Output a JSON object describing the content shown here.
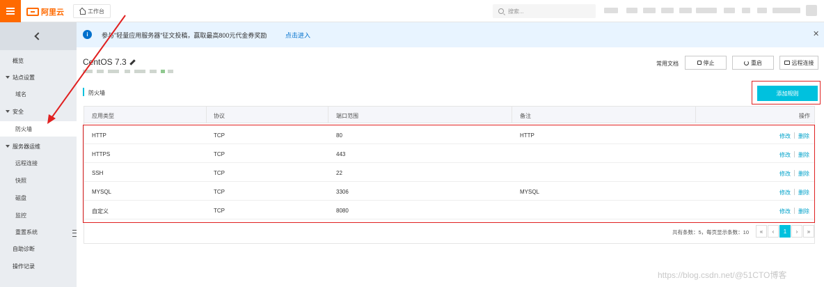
{
  "topbar": {
    "logo_text": "阿里云",
    "workbench_label": "工作台",
    "search_placeholder": "搜索..."
  },
  "sidebar": {
    "items": [
      {
        "label": "概览",
        "kind": "top"
      },
      {
        "label": "站点设置",
        "kind": "group"
      },
      {
        "label": "域名",
        "kind": "sub"
      },
      {
        "label": "安全",
        "kind": "group"
      },
      {
        "label": "防火墙",
        "kind": "sub",
        "active": true
      },
      {
        "label": "服务器运维",
        "kind": "group"
      },
      {
        "label": "远程连接",
        "kind": "sub"
      },
      {
        "label": "快照",
        "kind": "sub"
      },
      {
        "label": "磁盘",
        "kind": "sub"
      },
      {
        "label": "监控",
        "kind": "sub"
      },
      {
        "label": "重置系统",
        "kind": "sub"
      },
      {
        "label": "自助诊断",
        "kind": "top"
      },
      {
        "label": "操作记录",
        "kind": "top"
      }
    ]
  },
  "notice": {
    "text": "参与\"轻量应用服务器\"征文投稿，赢取最高800元代金券奖励",
    "link": "点击进入",
    "close": "✕"
  },
  "instance": {
    "title": "CentOS 7.3"
  },
  "actions": {
    "doc_link": "常用文档",
    "stop": "停止",
    "restart": "重启",
    "remote": "远程连接"
  },
  "firewall": {
    "section_title": "防火墙",
    "add_rule": "添加规则",
    "columns": [
      "应用类型",
      "协议",
      "端口范围",
      "备注",
      "操作"
    ],
    "rows": [
      {
        "type": "HTTP",
        "protocol": "TCP",
        "port": "80",
        "note": "HTTP"
      },
      {
        "type": "HTTPS",
        "protocol": "TCP",
        "port": "443",
        "note": ""
      },
      {
        "type": "SSH",
        "protocol": "TCP",
        "port": "22",
        "note": ""
      },
      {
        "type": "MYSQL",
        "protocol": "TCP",
        "port": "3306",
        "note": "MYSQL"
      },
      {
        "type": "自定义",
        "protocol": "TCP",
        "port": "8080",
        "note": ""
      }
    ],
    "op_edit": "修改",
    "op_delete": "删除"
  },
  "pager": {
    "summary": "共有条数：5，每页显示条数：10",
    "first": "«",
    "prev": "‹",
    "current": "1",
    "next": "›",
    "last": "»"
  },
  "watermark": "https://blog.csdn.net/@51CTO博客",
  "colors": {
    "brand": "#ff6a00",
    "accent": "#00c1de",
    "link": "#0070cc",
    "highlight": "#e02020"
  }
}
